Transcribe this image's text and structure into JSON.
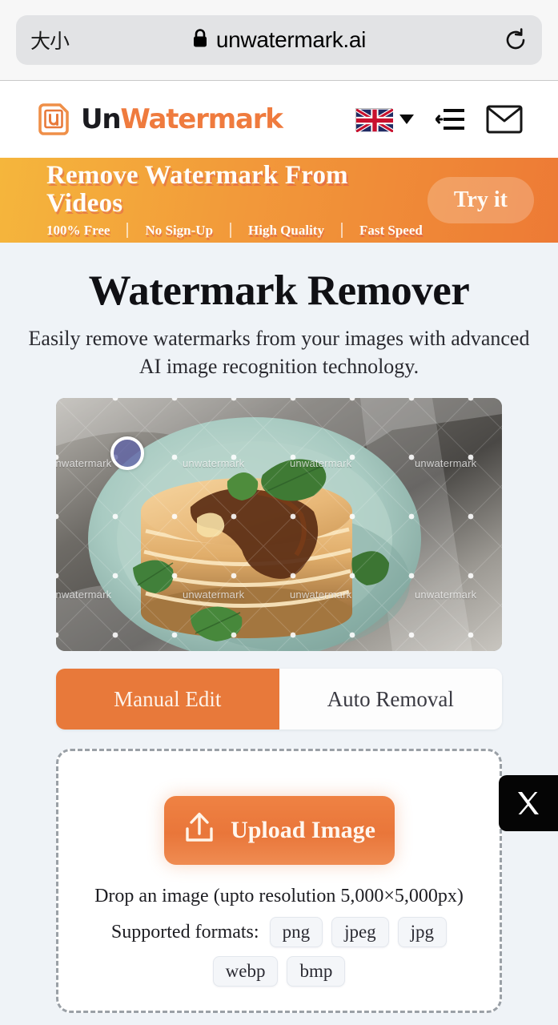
{
  "browser": {
    "font_size_button": "大小",
    "lock_icon": "lock-icon",
    "url": "unwatermark.ai",
    "reload_icon": "reload-icon"
  },
  "header": {
    "logo": {
      "icon": "unwatermark-logo-icon",
      "text_primary": "Un",
      "text_accent": "Watermark"
    },
    "language": {
      "flag": "uk-flag-icon",
      "caret": "chevron-down-icon"
    },
    "menu_icon": "menu-icon",
    "mail_icon": "envelope-icon"
  },
  "promo": {
    "title": "Remove Watermark From Videos",
    "features": [
      "100% Free",
      "No Sign-Up",
      "High Quality",
      "Fast Speed"
    ],
    "separator": "|",
    "cta": "Try it",
    "gradient_from": "#f5b63c",
    "gradient_to": "#ed7a35"
  },
  "hero": {
    "title": "Watermark Remover",
    "subtitle": "Easily remove watermarks from your images with advanced AI image recognition technology."
  },
  "preview": {
    "watermark_text": "unwatermark",
    "brush_cursor": "brush-cursor",
    "alt": "pancake-stack-preview"
  },
  "tabs": [
    {
      "label": "Manual Edit",
      "active": true
    },
    {
      "label": "Auto Removal",
      "active": false
    }
  ],
  "upload": {
    "button_label": "Upload Image",
    "button_icon": "upload-icon",
    "drop_hint": "Drop an image (upto resolution 5,000×5,000px)",
    "formats_label": "Supported formats:",
    "formats": [
      "png",
      "jpeg",
      "jpg",
      "webp",
      "bmp"
    ]
  },
  "social": {
    "x_icon": "x-twitter-icon",
    "x_label": "X"
  },
  "colors": {
    "accent": "#ef7b3e",
    "tab_active": "#e8793a",
    "page_bg": "#eff3f7"
  }
}
